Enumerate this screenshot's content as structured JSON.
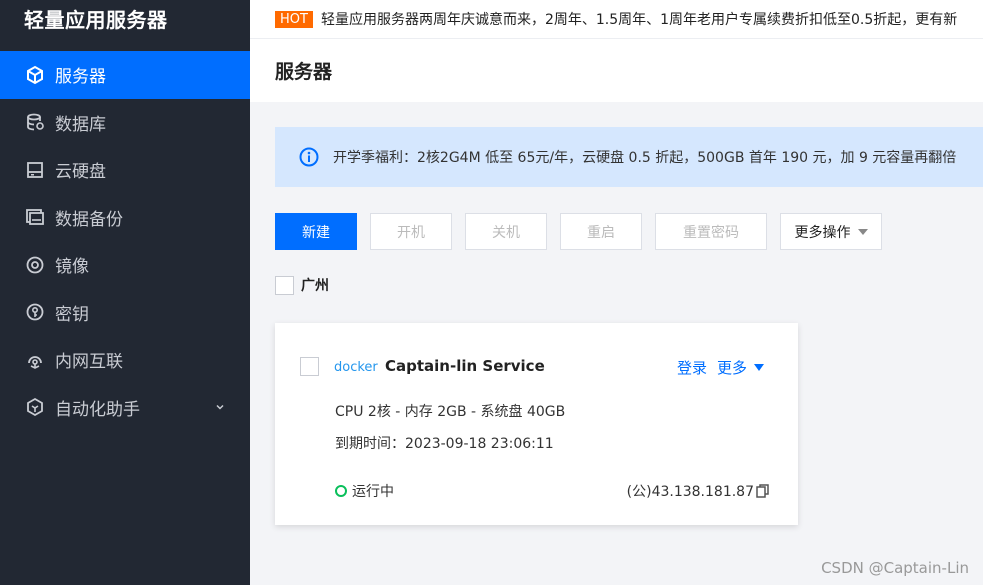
{
  "sidebar": {
    "title": "轻量应用服务器",
    "items": [
      {
        "label": "服务器",
        "icon": "cube-icon",
        "active": true
      },
      {
        "label": "数据库",
        "icon": "database-icon"
      },
      {
        "label": "云硬盘",
        "icon": "disk-icon"
      },
      {
        "label": "数据备份",
        "icon": "backup-icon"
      },
      {
        "label": "镜像",
        "icon": "image-disc-icon"
      },
      {
        "label": "密钥",
        "icon": "key-icon"
      },
      {
        "label": "内网互联",
        "icon": "network-icon"
      },
      {
        "label": "自动化助手",
        "icon": "robot-icon"
      }
    ]
  },
  "notice": {
    "badge": "HOT",
    "text": "轻量应用服务器两周年庆诚意而来，2周年、1.5周年、1周年老用户专属续费折扣低至0.5折起，更有新"
  },
  "page": {
    "title": "服务器"
  },
  "banner": {
    "text": "开学季福利：2核2G4M 低至 65元/年，云硬盘 0.5 折起，500GB 首年 190 元，加 9 元容量再翻倍"
  },
  "toolbar": {
    "new": "新建",
    "start": "开机",
    "stop": "关机",
    "restart": "重启",
    "reset_password": "重置密码",
    "more": "更多操作"
  },
  "region": {
    "label": "广州"
  },
  "instance": {
    "logo": "docker",
    "name": "Captain-lin Service",
    "login": "登录",
    "more": "更多",
    "spec": "CPU 2核 - 内存 2GB - 系统盘 40GB",
    "expire": "到期时间：2023-09-18 23:06:11",
    "status": "运行中",
    "ip": "(公)43.138.181.87"
  },
  "colors": {
    "accent": "#006eff",
    "sidebar_bg": "#222833",
    "running": "#0abf5b",
    "hot": "#ff6a00"
  },
  "watermark": "CSDN @Captain-Lin"
}
